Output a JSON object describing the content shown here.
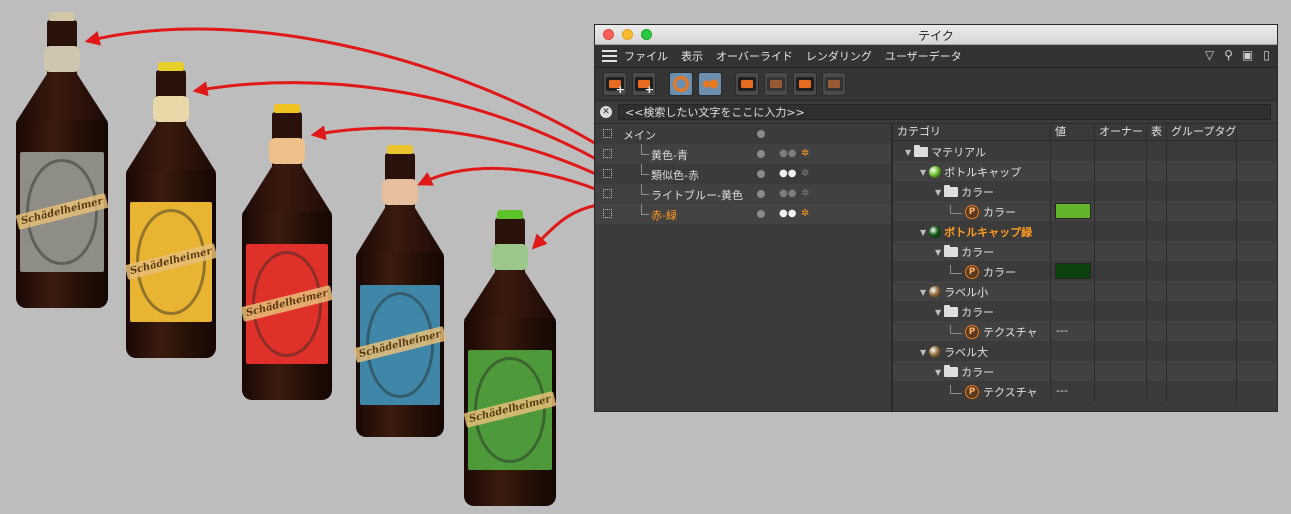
{
  "window": {
    "title": "テイク",
    "menu": [
      "ファイル",
      "表示",
      "オーバーライド",
      "レンダリング",
      "ユーザーデータ"
    ]
  },
  "search": {
    "placeholder": "<<検索したい文字をここに入力>>"
  },
  "takes": [
    {
      "name": "メイン",
      "depth": 0,
      "active": false,
      "cam_lit": false,
      "clap_lit": false,
      "has_icons": false
    },
    {
      "name": "黄色-青",
      "depth": 1,
      "active": false,
      "cam_lit": false,
      "clap_lit": true,
      "has_icons": true
    },
    {
      "name": "類似色-赤",
      "depth": 1,
      "active": false,
      "cam_lit": true,
      "clap_lit": false,
      "has_icons": true
    },
    {
      "name": "ライトブルー-黄色",
      "depth": 1,
      "active": false,
      "cam_lit": false,
      "clap_lit": false,
      "has_icons": true
    },
    {
      "name": "赤-緑",
      "depth": 1,
      "active": true,
      "cam_lit": true,
      "clap_lit": true,
      "has_icons": true
    }
  ],
  "overrides": {
    "columns": [
      "カテゴリ",
      "値",
      "オーナー",
      "表",
      "グループタグ"
    ],
    "rows": [
      {
        "label": "マテリアル",
        "depth": 0,
        "kind": "folder",
        "active": false,
        "value": ""
      },
      {
        "label": "ボトルキャップ",
        "depth": 1,
        "kind": "material",
        "ball": "#6fc12e",
        "active": false,
        "value": ""
      },
      {
        "label": "カラー",
        "depth": 2,
        "kind": "folder",
        "active": false,
        "value": ""
      },
      {
        "label": "カラー",
        "depth": 3,
        "kind": "param",
        "active": false,
        "value": "",
        "swatch": "#62b52a"
      },
      {
        "label": "ボトルキャップ緑",
        "depth": 1,
        "kind": "material",
        "ball": "#0f5a12",
        "active": true,
        "value": ""
      },
      {
        "label": "カラー",
        "depth": 2,
        "kind": "folder",
        "active": false,
        "value": ""
      },
      {
        "label": "カラー",
        "depth": 3,
        "kind": "param",
        "active": false,
        "value": "",
        "swatch": "#0b4210"
      },
      {
        "label": "ラベル小",
        "depth": 1,
        "kind": "material",
        "ball": "#8c6a3a",
        "active": false,
        "value": ""
      },
      {
        "label": "カラー",
        "depth": 2,
        "kind": "folder",
        "active": false,
        "value": ""
      },
      {
        "label": "テクスチャ",
        "depth": 3,
        "kind": "param",
        "active": false,
        "value": "---"
      },
      {
        "label": "ラベル大",
        "depth": 1,
        "kind": "material",
        "ball": "#8c6a3a",
        "active": false,
        "value": ""
      },
      {
        "label": "カラー",
        "depth": 2,
        "kind": "folder",
        "active": false,
        "value": ""
      },
      {
        "label": "テクスチャ",
        "depth": 3,
        "kind": "param",
        "active": false,
        "value": "---"
      }
    ]
  },
  "bottles": [
    {
      "name": "gray",
      "cap": "#d2c6a8",
      "label": "#8e8e86",
      "neck": "#cfc6b0"
    },
    {
      "name": "yellow-blue",
      "cap": "#e8d02a",
      "label": "#e8b431",
      "neck": "#e9d9a8"
    },
    {
      "name": "analogous-red",
      "cap": "#f1c21e",
      "label": "#e0302a",
      "neck": "#eec08a"
    },
    {
      "name": "lightblue-yellow",
      "cap": "#e9c32c",
      "label": "#3f87a8",
      "neck": "#e7bf9e"
    },
    {
      "name": "red-green",
      "cap": "#5ec22a",
      "label": "#4e9a3a",
      "neck": "#9cc88c"
    }
  ],
  "bottle_brand": "Schädelheimer",
  "colors": {
    "accent": "#ff9a1e",
    "arrow": "#e01818",
    "panel": "#3b3b3b"
  }
}
